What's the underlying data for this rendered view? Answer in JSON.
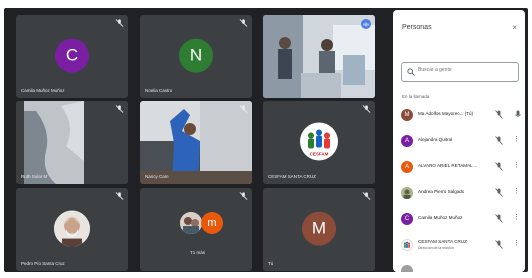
{
  "grid": {
    "tiles": [
      {
        "name": "Camila Muñoz Muñoz",
        "initial": "C",
        "color": "#7b1fa2",
        "kind": "initial"
      },
      {
        "name": "Noelia Castro",
        "initial": "N",
        "color": "#2e7d32",
        "kind": "initial"
      },
      {
        "name": "",
        "kind": "video"
      },
      {
        "name": "Ruth Solar M",
        "kind": "video"
      },
      {
        "name": "Nancy Cam",
        "kind": "video"
      },
      {
        "name": "CESFAM SANTA CRUZ",
        "kind": "logo",
        "logo_text": "CESFAM"
      },
      {
        "name": "Pedro Pío Santa Cruz",
        "kind": "photo"
      },
      {
        "name": "T1 más",
        "initial": "m",
        "color": "#e8590c",
        "kind": "group"
      },
      {
        "name": "Tú",
        "initial": "M",
        "color": "#8d4b3a",
        "kind": "initial"
      }
    ]
  },
  "panel": {
    "title": "Personas",
    "close": "×",
    "search_placeholder": "Buscar a gente",
    "section": "En la llamada",
    "participants": [
      {
        "name": "Ma Adolfos Mayorec... (Tú)",
        "initial": "M",
        "color": "#8d4b3a"
      },
      {
        "name": "Alejandra Quitral",
        "initial": "A",
        "color": "#7b1fa2"
      },
      {
        "name": "ALVARO ARIEL RETAMAL ...",
        "initial": "A",
        "color": "#e8590c"
      },
      {
        "name": "Andrea Pierro Salgado",
        "initial": "",
        "color": "#8d9e6b"
      },
      {
        "name": "Camila Muñoz Muñoz",
        "initial": "C",
        "color": "#7b1fa2"
      },
      {
        "name": "CESFAM SANTA CRUZ",
        "sub": "Dirección de la reunión",
        "initial": "",
        "color": "#ffffff"
      },
      {
        "name": "",
        "initial": "",
        "color": "#9e9e9e"
      }
    ]
  }
}
